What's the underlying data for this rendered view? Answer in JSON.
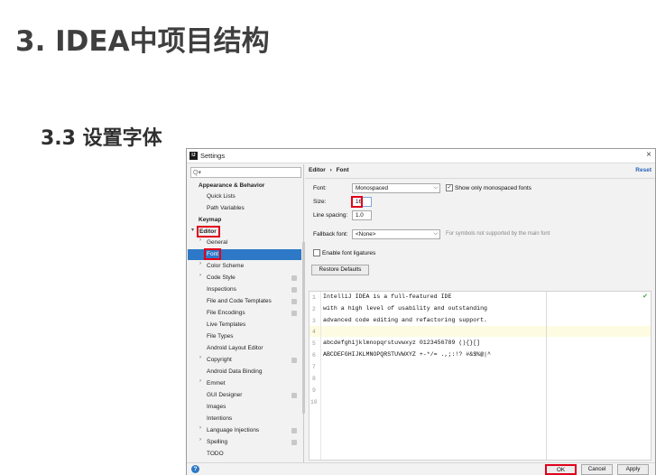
{
  "slide": {
    "title": "3. IDEA中项目结构",
    "subtitle": "3.3 设置字体"
  },
  "dialog": {
    "title": "Settings",
    "close_icon": "×",
    "search_placeholder": "Q▾"
  },
  "sidebar": {
    "items": [
      {
        "label": "Appearance & Behavior",
        "bold": true
      },
      {
        "label": "Quick Lists"
      },
      {
        "label": "Path Variables"
      },
      {
        "label": "Keymap",
        "bold": true
      },
      {
        "label": "Editor",
        "bold": true,
        "expanded": true
      },
      {
        "label": "General"
      },
      {
        "label": "Font",
        "selected": true
      },
      {
        "label": "Color Scheme"
      },
      {
        "label": "Code Style"
      },
      {
        "label": "Inspections"
      },
      {
        "label": "File and Code Templates"
      },
      {
        "label": "File Encodings"
      },
      {
        "label": "Live Templates"
      },
      {
        "label": "File Types"
      },
      {
        "label": "Android Layout Editor"
      },
      {
        "label": "Copyright"
      },
      {
        "label": "Android Data Binding"
      },
      {
        "label": "Emmet"
      },
      {
        "label": "GUI Designer"
      },
      {
        "label": "Images"
      },
      {
        "label": "Intentions"
      },
      {
        "label": "Language Injections"
      },
      {
        "label": "Spelling"
      },
      {
        "label": "TODO"
      }
    ]
  },
  "main": {
    "breadcrumb_parent": "Editor",
    "breadcrumb_sep": "›",
    "breadcrumb_current": "Font",
    "reset_label": "Reset",
    "font_label": "Font:",
    "font_value": "Monospaced",
    "monospaced_only_label": "Show only monospaced fonts",
    "monospaced_only_checked": true,
    "size_label": "Size:",
    "size_value": "16",
    "line_spacing_label": "Line spacing:",
    "line_spacing_value": "1.0",
    "fallback_label": "Fallback font:",
    "fallback_value": "<None>",
    "fallback_hint": "For symbols not supported by the main font",
    "ligatures_label": "Enable font ligatures",
    "ligatures_checked": false,
    "restore_defaults_label": "Restore Defaults"
  },
  "preview": {
    "lines": [
      {
        "n": "1",
        "text": "IntelliJ IDEA is a full-featured IDE"
      },
      {
        "n": "2",
        "text": "with a high level of usability and outstanding"
      },
      {
        "n": "3",
        "text": "advanced code editing and refactoring support."
      },
      {
        "n": "4",
        "text": ""
      },
      {
        "n": "5",
        "text": "abcdefghijklmnopqrstuvwxyz 0123456789 (){}[]"
      },
      {
        "n": "6",
        "text": "ABCDEFGHIJKLMNOPQRSTUVWXYZ +-*/= .,;:!? #&$%@|^"
      },
      {
        "n": "7",
        "text": ""
      },
      {
        "n": "8",
        "text": ""
      },
      {
        "n": "9",
        "text": ""
      },
      {
        "n": "10",
        "text": ""
      }
    ],
    "status_mark": "✔"
  },
  "footer": {
    "help_icon": "?",
    "ok_label": "OK",
    "cancel_label": "Cancel",
    "apply_label": "Apply"
  },
  "colors": {
    "selection": "#2d79c7",
    "highlight_box": "#e0001b",
    "link": "#2a63b6"
  }
}
